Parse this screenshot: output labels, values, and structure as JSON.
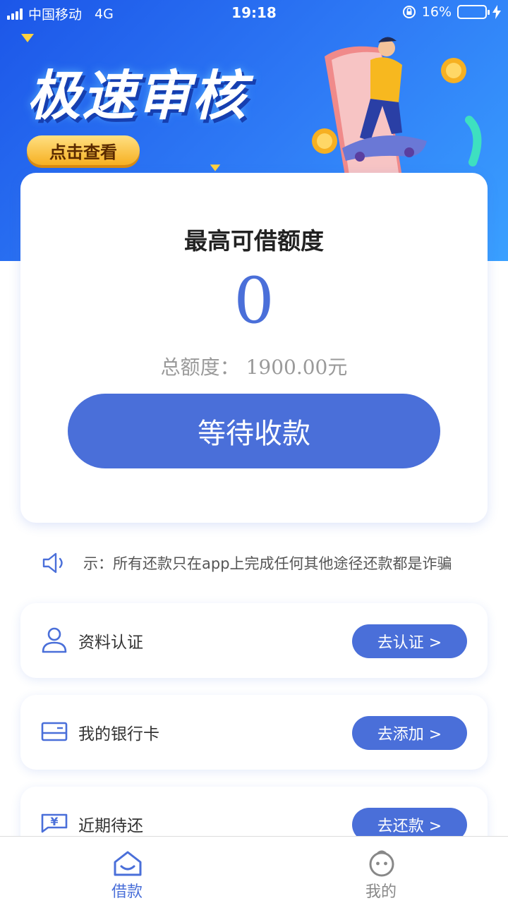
{
  "status_bar": {
    "carrier": "中国移动",
    "network": "4G",
    "time": "19:18",
    "battery": "16%",
    "battery_level": 0.16
  },
  "banner": {
    "title": "极速审核",
    "cta_label": "点击查看"
  },
  "credit_card": {
    "title": "最高可借额度",
    "amount": "0",
    "total_label": "总额度：",
    "total_value": "1900.00元",
    "button_label": "等待收款"
  },
  "notice": {
    "text": "示：所有还款只在app上完成任何其他途径还款都是诈骗"
  },
  "rows": [
    {
      "icon": "user-icon",
      "label": "资料认证",
      "button": "去认证 >"
    },
    {
      "icon": "bank-card-icon",
      "label": "我的银行卡",
      "button": "去添加 >"
    },
    {
      "icon": "yuan-bill-icon",
      "label": "近期待还",
      "button": "去还款 >"
    }
  ],
  "tabs": [
    {
      "icon": "home-icon",
      "label": "借款",
      "active": true
    },
    {
      "icon": "profile-face-icon",
      "label": "我的",
      "active": false
    }
  ],
  "colors": {
    "accent": "#4a6fd9",
    "banner_start": "#1c56e8",
    "banner_end": "#3aa0ff",
    "cta_gold": "#f6b022",
    "inactive_tab": "#888888"
  }
}
